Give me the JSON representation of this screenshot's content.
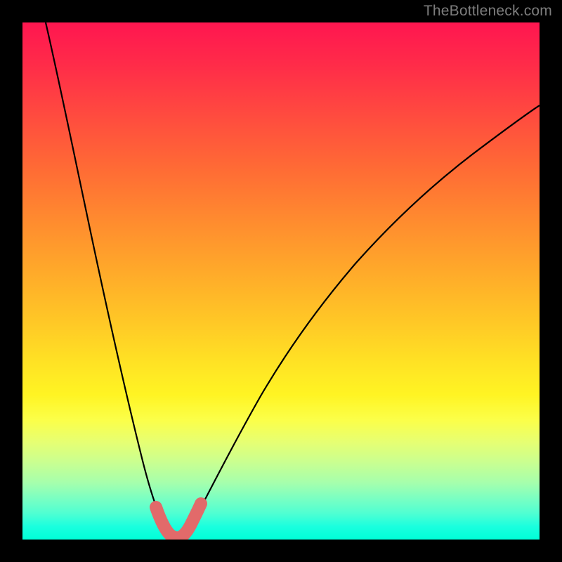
{
  "watermark": "TheBottleneck.com",
  "colors": {
    "frame": "#000000",
    "curve_stroke": "#000000",
    "highlight_stroke": "#e26a6a",
    "gradient_stops": [
      {
        "offset": 0,
        "color": "#ff1650"
      },
      {
        "offset": 0.08,
        "color": "#ff2b49"
      },
      {
        "offset": 0.18,
        "color": "#ff4b3f"
      },
      {
        "offset": 0.28,
        "color": "#ff6a35"
      },
      {
        "offset": 0.38,
        "color": "#ff8a2f"
      },
      {
        "offset": 0.48,
        "color": "#ffa92a"
      },
      {
        "offset": 0.58,
        "color": "#ffc826"
      },
      {
        "offset": 0.66,
        "color": "#ffe324"
      },
      {
        "offset": 0.72,
        "color": "#fff423"
      },
      {
        "offset": 0.77,
        "color": "#fbff4a"
      },
      {
        "offset": 0.81,
        "color": "#e7ff71"
      },
      {
        "offset": 0.85,
        "color": "#caff90"
      },
      {
        "offset": 0.89,
        "color": "#a6ffac"
      },
      {
        "offset": 0.92,
        "color": "#7bffc2"
      },
      {
        "offset": 0.95,
        "color": "#4effd2"
      },
      {
        "offset": 0.975,
        "color": "#1affde"
      },
      {
        "offset": 1.0,
        "color": "#00ffd8"
      }
    ]
  },
  "chart_data": {
    "type": "line",
    "title": "",
    "xlabel": "",
    "ylabel": "",
    "x_range": [
      0,
      1
    ],
    "y_range": [
      0,
      1
    ],
    "x_min_at": 0.29,
    "description": "Single V-shaped curve descending steeply from upper-left, bottoming near x≈0.29 with a short flat segment, then rising with decreasing slope toward the right edge. A thick light-red overlay marks the flat bottom region.",
    "series": [
      {
        "name": "bottleneck-curve",
        "points": [
          {
            "x": 0.045,
            "y": 1.0
          },
          {
            "x": 0.09,
            "y": 0.82
          },
          {
            "x": 0.13,
            "y": 0.64
          },
          {
            "x": 0.165,
            "y": 0.47
          },
          {
            "x": 0.195,
            "y": 0.32
          },
          {
            "x": 0.22,
            "y": 0.2
          },
          {
            "x": 0.24,
            "y": 0.11
          },
          {
            "x": 0.255,
            "y": 0.055
          },
          {
            "x": 0.268,
            "y": 0.02
          },
          {
            "x": 0.28,
            "y": 0.006
          },
          {
            "x": 0.29,
            "y": 0.004
          },
          {
            "x": 0.3,
            "y": 0.006
          },
          {
            "x": 0.315,
            "y": 0.02
          },
          {
            "x": 0.335,
            "y": 0.06
          },
          {
            "x": 0.37,
            "y": 0.14
          },
          {
            "x": 0.42,
            "y": 0.25
          },
          {
            "x": 0.48,
            "y": 0.37
          },
          {
            "x": 0.55,
            "y": 0.48
          },
          {
            "x": 0.63,
            "y": 0.58
          },
          {
            "x": 0.72,
            "y": 0.67
          },
          {
            "x": 0.82,
            "y": 0.745
          },
          {
            "x": 0.92,
            "y": 0.805
          },
          {
            "x": 1.0,
            "y": 0.845
          }
        ]
      },
      {
        "name": "highlight-bottom",
        "stroke": "#e26a6a",
        "stroke_width_px": 18,
        "points": [
          {
            "x": 0.252,
            "y": 0.062
          },
          {
            "x": 0.262,
            "y": 0.028
          },
          {
            "x": 0.275,
            "y": 0.01
          },
          {
            "x": 0.29,
            "y": 0.006
          },
          {
            "x": 0.305,
            "y": 0.01
          },
          {
            "x": 0.32,
            "y": 0.03
          },
          {
            "x": 0.33,
            "y": 0.06
          }
        ]
      }
    ]
  }
}
